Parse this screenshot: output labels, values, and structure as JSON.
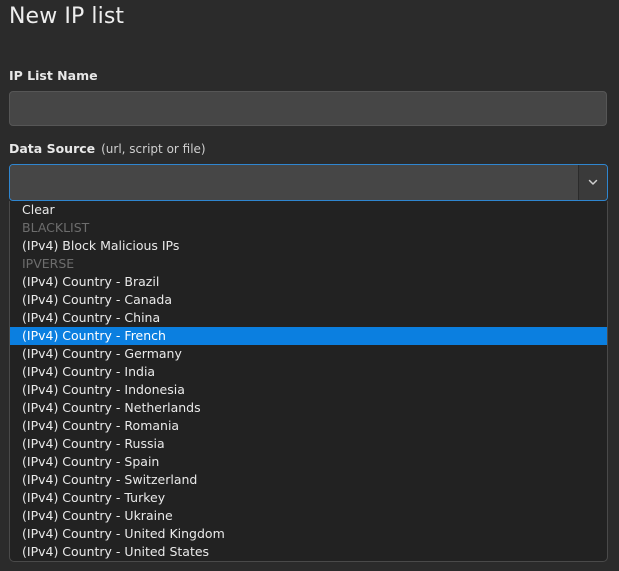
{
  "page": {
    "title": "New IP list"
  },
  "form": {
    "name_label": "IP List Name",
    "name_value": "",
    "source_label": "Data Source",
    "source_hint": "(url, script or file)",
    "source_value": ""
  },
  "icons": {
    "dropdown_toggle": "chevron-down-icon"
  },
  "dropdown": {
    "options": [
      {
        "label": "Clear",
        "kind": "option"
      },
      {
        "label": "BLACKLIST",
        "kind": "group"
      },
      {
        "label": "(IPv4) Block Malicious IPs",
        "kind": "option"
      },
      {
        "label": "IPVERSE",
        "kind": "group"
      },
      {
        "label": "(IPv4) Country - Brazil",
        "kind": "option"
      },
      {
        "label": "(IPv4) Country - Canada",
        "kind": "option"
      },
      {
        "label": "(IPv4) Country - China",
        "kind": "option"
      },
      {
        "label": "(IPv4) Country - French",
        "kind": "option",
        "highlighted": true
      },
      {
        "label": "(IPv4) Country - Germany",
        "kind": "option"
      },
      {
        "label": "(IPv4) Country - India",
        "kind": "option"
      },
      {
        "label": "(IPv4) Country - Indonesia",
        "kind": "option"
      },
      {
        "label": "(IPv4) Country - Netherlands",
        "kind": "option"
      },
      {
        "label": "(IPv4) Country - Romania",
        "kind": "option"
      },
      {
        "label": "(IPv4) Country - Russia",
        "kind": "option"
      },
      {
        "label": "(IPv4) Country - Spain",
        "kind": "option"
      },
      {
        "label": "(IPv4) Country - Switzerland",
        "kind": "option"
      },
      {
        "label": "(IPv4) Country - Turkey",
        "kind": "option"
      },
      {
        "label": "(IPv4) Country - Ukraine",
        "kind": "option"
      },
      {
        "label": "(IPv4) Country - United Kingdom",
        "kind": "option"
      },
      {
        "label": "(IPv4) Country - United States",
        "kind": "option"
      }
    ]
  },
  "colors": {
    "background": "#2b2b2b",
    "input_bg": "#464646",
    "focus_border": "#2f86d0",
    "highlight": "#0b7fe0",
    "group_label": "#6d6d6d"
  }
}
